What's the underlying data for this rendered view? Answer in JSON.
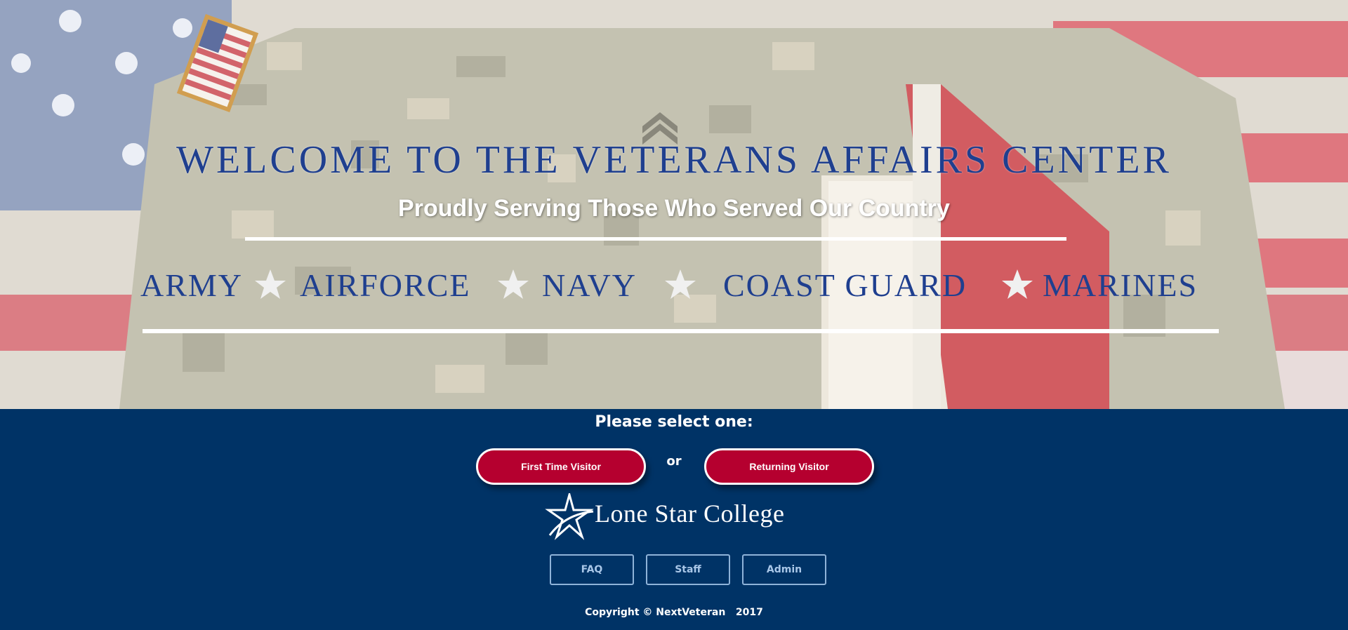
{
  "hero": {
    "welcome": "Welcome to the Veterans Affairs Center",
    "subtitle": "Proudly Serving Those Who Served Our Country",
    "branches": [
      "ARMY",
      "AIRFORCE",
      "NAVY",
      "COAST GUARD",
      "MARINES"
    ]
  },
  "selection": {
    "prompt": "Please select one:",
    "first_time": "First Time Visitor",
    "or": "or",
    "returning": "Returning Visitor"
  },
  "logo": {
    "text": "Lone Star College",
    "icon": "star-swoosh-icon"
  },
  "links": {
    "faq": "FAQ",
    "staff": "Staff",
    "admin": "Admin"
  },
  "copyright": "Copyright © NextVeteran   2017",
  "colors": {
    "navy": "#003366",
    "red_button": "#b5002f",
    "title_blue": "#1f3f8f"
  }
}
